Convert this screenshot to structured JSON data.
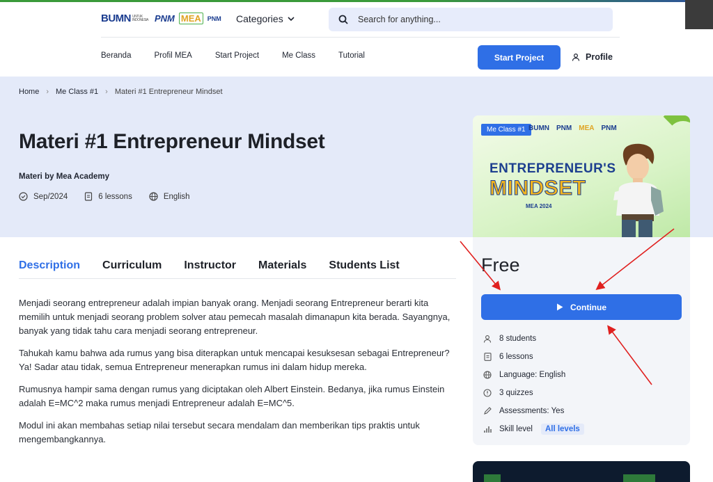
{
  "header": {
    "logos": {
      "bumn": "BUMN",
      "bumn_sub": "UNTUK INDONESIA",
      "pnm": "PNM",
      "mea": "MEA",
      "pnm2": "PNM"
    },
    "categories_label": "Categories",
    "search_placeholder": "Search for anything...",
    "nav": [
      "Beranda",
      "Profil MEA",
      "Start Project",
      "Me Class",
      "Tutorial"
    ],
    "start_project_label": "Start Project",
    "profile_label": "Profile"
  },
  "breadcrumb": [
    "Home",
    "Me Class #1",
    "Materi #1 Entrepreneur Mindset"
  ],
  "course": {
    "title": "Materi #1 Entrepreneur Mindset",
    "byline_prefix": "Materi by",
    "author": "Mea Academy",
    "date": "Sep/2024",
    "lessons": "6 lessons",
    "language": "English"
  },
  "thumbnail": {
    "badge": "Me Class #1",
    "line1": "ENTREPRENEUR'S",
    "line2": "MINDSET",
    "line3": "MEA 2024"
  },
  "sidebar": {
    "price": "Free",
    "continue_label": "Continue",
    "features": [
      {
        "icon": "user-icon",
        "text": "8 students"
      },
      {
        "icon": "document-icon",
        "text": "6 lessons"
      },
      {
        "icon": "globe-icon",
        "text": "Language: English"
      },
      {
        "icon": "info-icon",
        "text": "3 quizzes"
      },
      {
        "icon": "pencil-icon",
        "text": "Assessments: Yes"
      }
    ],
    "skill_label": "Skill level",
    "skill_value": "All levels"
  },
  "tabs": [
    "Description",
    "Curriculum",
    "Instructor",
    "Materials",
    "Students List"
  ],
  "description": [
    "Menjadi seorang entrepreneur adalah impian banyak orang. Menjadi seorang Entrepreneur berarti kita memilih untuk menjadi seorang problem solver atau pemecah masalah dimanapun kita berada.  Sayangnya, banyak yang tidak tahu cara menjadi seorang entrepreneur.",
    "Tahukah kamu bahwa ada rumus yang bisa diterapkan untuk mencapai kesuksesan sebagai Entrepreneur? Ya! Sadar atau tidak, semua Entrepreneur menerapkan rumus ini dalam hidup mereka.",
    "Rumusnya hampir sama dengan rumus yang diciptakan oleh Albert Einstein. Bedanya, jika rumus Einstein adalah  E=MC^2 maka rumus menjadi Entrepreneur adalah E=MC^5.",
    "Modul ini akan membahas setiap nilai tersebut secara mendalam dan memberikan tips praktis untuk mengembangkannya."
  ],
  "colors": {
    "accent": "#2f6fe6",
    "hero_bg": "#e4eaf9",
    "annotation": "#e0201f"
  }
}
